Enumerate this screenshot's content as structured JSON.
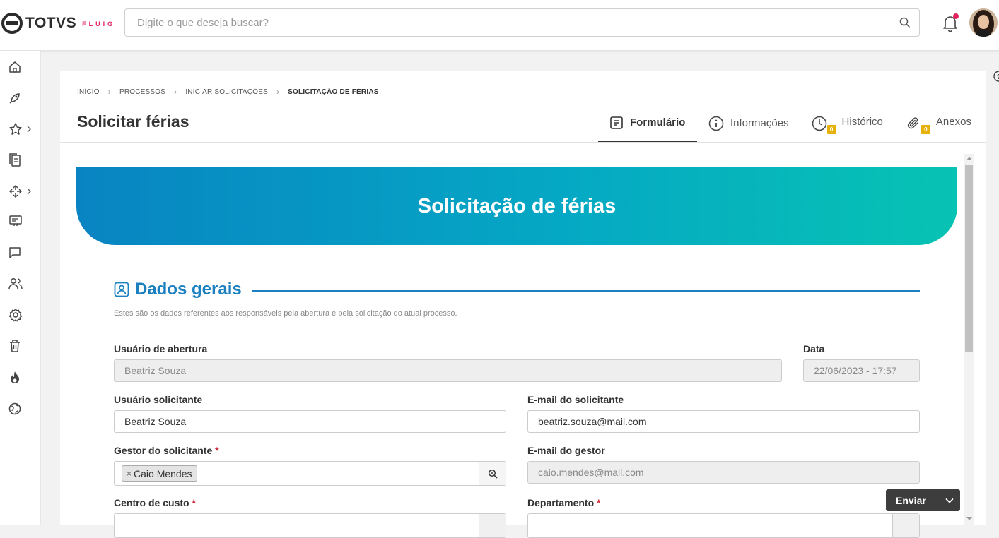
{
  "brand": {
    "name": "TOTVS",
    "product": "FLUIG"
  },
  "search": {
    "placeholder": "Digite o que deseja buscar?",
    "value": ""
  },
  "breadcrumb": [
    "INÍCIO",
    "PROCESSOS",
    "INICIAR SOLICITAÇÕES",
    "SOLICITAÇÃO DE FÉRIAS"
  ],
  "page": {
    "title": "Solicitar férias"
  },
  "tabs": [
    {
      "label": "Formulário",
      "active": true,
      "icon": "form-icon"
    },
    {
      "label": "Informações",
      "icon": "info-icon"
    },
    {
      "label": "Histórico",
      "badge": "0",
      "icon": "clock-icon"
    },
    {
      "label": "Anexos",
      "badge": "0",
      "icon": "paperclip-icon"
    }
  ],
  "sidebar": {
    "items": [
      {
        "icon": "home-icon"
      },
      {
        "icon": "rocket-icon"
      },
      {
        "icon": "star-icon",
        "has_submenu": true
      },
      {
        "icon": "documents-icon"
      },
      {
        "icon": "process-icon",
        "has_submenu": true
      },
      {
        "icon": "presentation-icon"
      },
      {
        "icon": "chat-icon"
      },
      {
        "icon": "users-icon"
      },
      {
        "icon": "gear-icon"
      },
      {
        "icon": "trash-icon"
      },
      {
        "icon": "fire-icon"
      },
      {
        "icon": "globe-icon"
      }
    ]
  },
  "form": {
    "banner_title": "Solicitação de férias",
    "section": {
      "title": "Dados gerais",
      "description": "Estes são os dados referentes aos responsáveis pela abertura e pela solicitação do atual processo."
    },
    "fields": {
      "usuario_abertura": {
        "label": "Usuário de abertura",
        "value": "Beatriz Souza"
      },
      "data": {
        "label": "Data",
        "value": "22/06/2023 - 17:57"
      },
      "usuario_solicitante": {
        "label": "Usuário solicitante",
        "value": "Beatriz Souza"
      },
      "email_solicitante": {
        "label": "E-mail do solicitante",
        "value": "beatriz.souza@mail.com"
      },
      "gestor_solicitante": {
        "label": "Gestor do solicitante",
        "required": "*",
        "tag_value": "Caio Mendes",
        "tag_remove": "×"
      },
      "email_gestor": {
        "label": "E-mail do gestor",
        "value": "caio.mendes@mail.com"
      },
      "centro_custo": {
        "label": "Centro de custo",
        "required": "*"
      },
      "departamento": {
        "label": "Departamento",
        "required": "*"
      }
    }
  },
  "actions": {
    "send_label": "Enviar"
  },
  "colors": {
    "accent": "#1a80c0",
    "banner_start": "#0884c2",
    "banner_end": "#07c3b3",
    "badge": "#e6b10b",
    "notification": "#e0245e"
  }
}
